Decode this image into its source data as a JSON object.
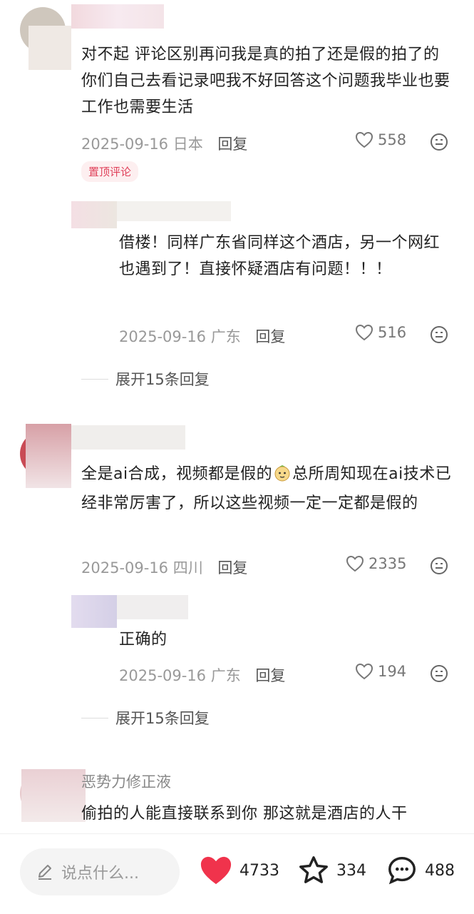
{
  "comments": [
    {
      "text": "对不起 评论区别再问我是真的拍了还是假的拍了的 你们自己去看记录吧我不好回答这个问题我毕业也要工作也需要生活",
      "date": "2025-09-16",
      "location": "日本",
      "reply_label": "回复",
      "likes": "558",
      "badge": "置顶评论"
    },
    {
      "text": "借楼！同样广东省同样这个酒店，另一个网红也遇到了！直接怀疑酒店有问题！！！",
      "date": "2025-09-16",
      "location": "广东",
      "reply_label": "回复",
      "likes": "516"
    },
    {
      "text_part1": "全是ai合成，视频都是假的",
      "text_part2": "总所周知现在ai技术已经非常厉害了，所以这些视频一定一定都是假的",
      "date": "2025-09-16",
      "location": "四川",
      "reply_label": "回复",
      "likes": "2335"
    },
    {
      "text": "正确的",
      "date": "2025-09-16",
      "location": "广东",
      "reply_label": "回复",
      "likes": "194"
    },
    {
      "username": "恶势力修正液",
      "text": "偷拍的人能直接联系到你 那这就是酒店的人干"
    }
  ],
  "expand": [
    {
      "label": "展开15条回复"
    },
    {
      "label": "展开15条回复"
    }
  ],
  "bottom_bar": {
    "input_placeholder": "说点什么...",
    "like_count": "4733",
    "star_count": "334",
    "comment_count": "488",
    "like_color": "#f0334c"
  },
  "icons": [
    "heart-outline-icon",
    "emoji-icon",
    "pencil-icon",
    "heart-filled-icon",
    "star-icon",
    "comment-bubble-icon"
  ]
}
